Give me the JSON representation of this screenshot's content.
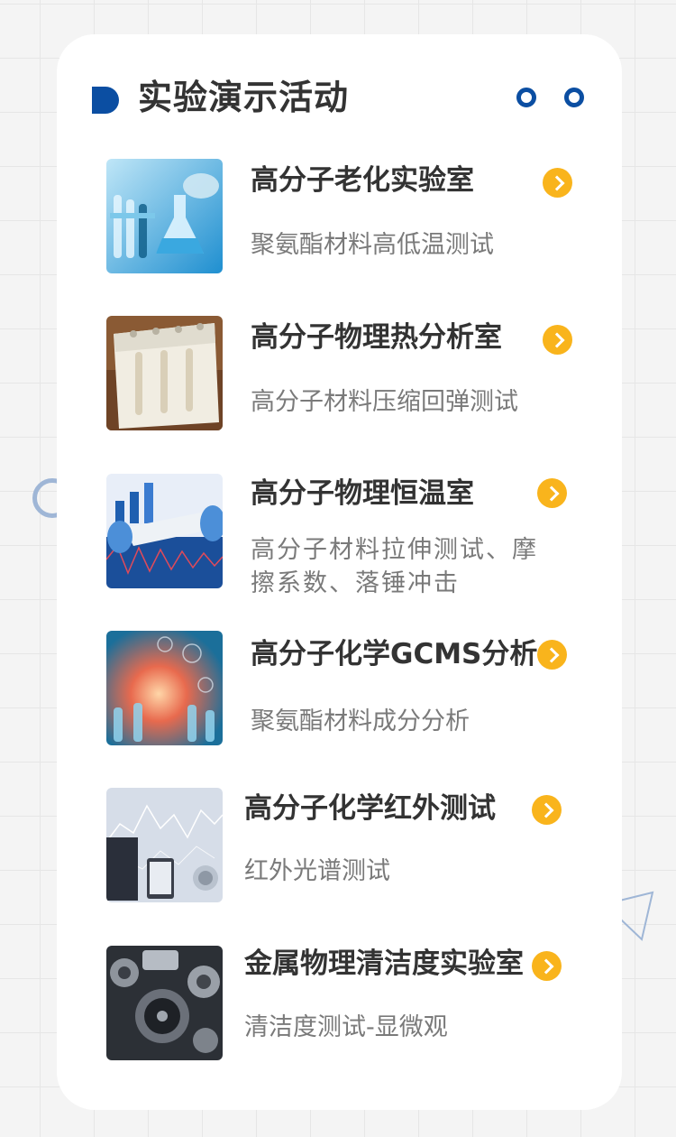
{
  "header": {
    "title": "实验演示活动"
  },
  "items": [
    {
      "title": "高分子老化实验室",
      "desc": "聚氨酯材料高低温测试",
      "image": "lab-glassware-photo"
    },
    {
      "title": "高分子物理热分析室",
      "desc": "高分子材料压缩回弹测试",
      "image": "foam-sample-photo"
    },
    {
      "title": "高分子物理恒温室",
      "desc": "高分子材料拉伸测试、摩擦系数、落锤冲击",
      "image": "material-stretch-photo"
    },
    {
      "title": "高分子化学GCMS分析",
      "desc": "聚氨酯材料成分分析",
      "image": "chemistry-lab-photo"
    },
    {
      "title": "高分子化学红外测试",
      "desc": "红外光谱测试",
      "image": "infrared-data-photo"
    },
    {
      "title": "金属物理清洁度实验室",
      "desc": "清洁度测试-显微观",
      "image": "engine-parts-photo"
    }
  ],
  "colors": {
    "accent": "#0b4ea2",
    "arrow": "#f9b41c",
    "title": "#333333",
    "desc": "#7a7a7a"
  },
  "icons": {
    "arrow": "chevron-right-icon"
  }
}
